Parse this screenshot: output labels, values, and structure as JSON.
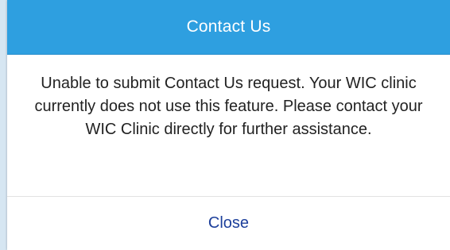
{
  "dialog": {
    "title": "Contact Us",
    "message": "Unable to submit Contact Us request. Your WIC clinic currently does not use this feature. Please contact your WIC Clinic directly for further assistance.",
    "close_label": "Close"
  },
  "colors": {
    "header_background": "#2e9fe0",
    "header_text": "#ffffff",
    "link_text": "#1c3f9b",
    "backdrop": "#d6e6f2"
  }
}
